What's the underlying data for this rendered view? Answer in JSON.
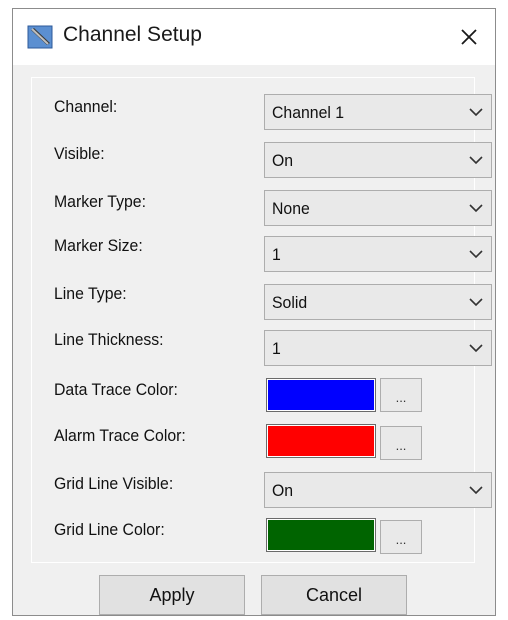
{
  "window": {
    "title": "Channel Setup",
    "icon": "pencil-ruler-icon",
    "close": "close-icon"
  },
  "fields": [
    {
      "label": "Channel:",
      "type": "select",
      "value": "Channel 1"
    },
    {
      "label": "Visible:",
      "type": "select",
      "value": "On"
    },
    {
      "label": "Marker Type:",
      "type": "select",
      "value": "None"
    },
    {
      "label": "Marker Size:",
      "type": "select",
      "value": "1"
    },
    {
      "label": "Line Type:",
      "type": "select",
      "value": "Solid"
    },
    {
      "label": "Line Thickness:",
      "type": "select",
      "value": "1"
    },
    {
      "label": "Data Trace Color:",
      "type": "color",
      "color": "#0000ff",
      "button": "..."
    },
    {
      "label": "Alarm Trace Color:",
      "type": "color",
      "color": "#ff0000",
      "button": "..."
    },
    {
      "label": "Grid Line Visible:",
      "type": "select",
      "value": "On"
    },
    {
      "label": "Grid Line Color:",
      "type": "color",
      "color": "#006400",
      "button": "..."
    }
  ],
  "buttons": {
    "apply": "Apply",
    "cancel": "Cancel"
  }
}
